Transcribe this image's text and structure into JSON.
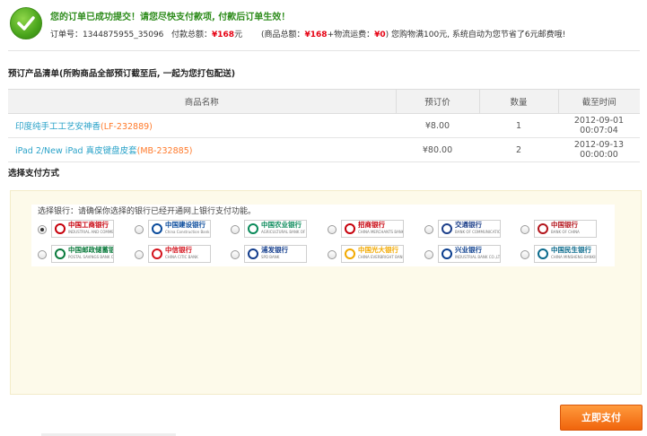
{
  "header": {
    "success_message": "您的订单已成功提交！请您尽快支付款项, 付款后订单生效！",
    "order_no_label": "订单号：",
    "order_no": "1344875955_35096",
    "total_label": "付款总额：",
    "total_amount": "¥168",
    "total_unit": "元",
    "breakdown_prefix": "(商品总额：",
    "goods_amount": "¥168",
    "breakdown_mid": "+物流运费：",
    "shipping_amount": "¥0",
    "breakdown_suffix": ")",
    "saving_note": "您购物满100元, 系统自动为您节省了6元邮费哦!"
  },
  "preorder": {
    "title": "预订产品清单(所购商品全部预订截至后, 一起为您打包配送)",
    "columns": [
      "商品名称",
      "预订价",
      "数量",
      "截至时间"
    ],
    "rows": [
      {
        "name": "印度纯手工工艺安神香",
        "code": "(LF-232889)",
        "price": "¥8.00",
        "qty": "1",
        "deadline": "2012-09-01 00:07:04"
      },
      {
        "name": "iPad 2/New iPad 真皮键盘皮套",
        "code": "(MB-232885)",
        "price": "¥80.00",
        "qty": "2",
        "deadline": "2012-09-13 00:00:00"
      }
    ]
  },
  "payment": {
    "title": "选择支付方式",
    "bank_hint": "选择银行：请确保你选择的银行已经开通网上银行支付功能。",
    "banks": [
      {
        "name": "中国工商银行",
        "sub": "INDUSTRIAL AND COMMERCIAL BANK OF CHINA",
        "color": "#c7000b",
        "selected": true
      },
      {
        "name": "中国建设银行",
        "sub": "China Construction Bank",
        "color": "#0a4b9c",
        "selected": false
      },
      {
        "name": "中国农业银行",
        "sub": "AGRICULTURAL BANK OF CHINA",
        "color": "#0a8a5a",
        "selected": false
      },
      {
        "name": "招商银行",
        "sub": "CHINA MERCHANTS BANK",
        "color": "#c7000b",
        "selected": false
      },
      {
        "name": "交通银行",
        "sub": "BANK OF COMMUNICATIONS",
        "color": "#1c3f8a",
        "selected": false
      },
      {
        "name": "中国银行",
        "sub": "BANK OF CHINA",
        "color": "#b3151c",
        "selected": false
      },
      {
        "name": "中国邮政储蓄银行",
        "sub": "POSTAL SAVINGS BANK OF CHINA",
        "color": "#0a7a3c",
        "selected": false
      },
      {
        "name": "中信银行",
        "sub": "CHINA CITIC BANK",
        "color": "#d4121c",
        "selected": false
      },
      {
        "name": "浦发银行",
        "sub": "SPD BANK",
        "color": "#123c8c",
        "selected": false
      },
      {
        "name": "中国光大银行",
        "sub": "CHINA EVERBRIGHT BANK",
        "color": "#f2a900",
        "selected": false
      },
      {
        "name": "兴业银行",
        "sub": "INDUSTRIAL BANK CO.,LTD.",
        "color": "#0b3e8e",
        "selected": false
      },
      {
        "name": "中国民生银行",
        "sub": "CHINA MINSHENG BANKING CORP.,LTD.",
        "color": "#0a6a8c",
        "selected": false
      }
    ],
    "submit_label": "立即支付"
  },
  "colors": {
    "success_green": "#2e8c1c",
    "price_red": "#e60012",
    "link_blue": "#2ba3c9",
    "code_orange": "#ff7a2b",
    "button_orange": "#f0640c",
    "panel_bg": "#fdfaea"
  }
}
